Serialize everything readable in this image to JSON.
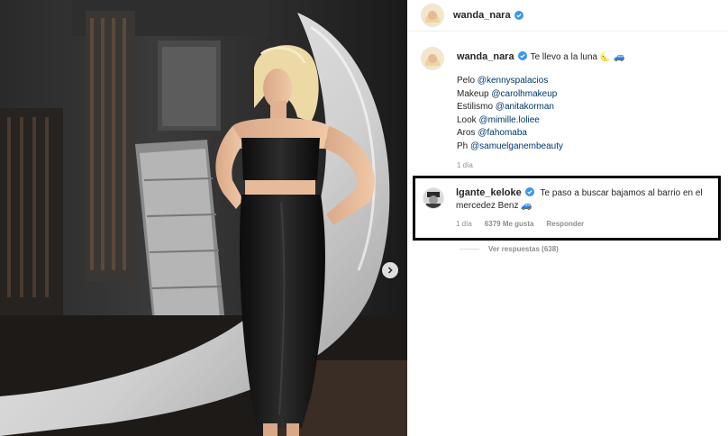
{
  "colors": {
    "accent": "#3897f0",
    "link": "#00376b",
    "muted": "#8e8e8e",
    "highlight_border": "#000000"
  },
  "post": {
    "author": "wanda_nara",
    "photo_alt": "",
    "carousel_next_icon": "chevron-right-icon"
  },
  "caption": {
    "author": "wanda_nara",
    "text": "Te llevo a la luna 🌜 🚙",
    "credits": [
      {
        "label": "Pelo ",
        "mention": "@kennyspalacios"
      },
      {
        "label": "Makeup ",
        "mention": "@carolhmakeup"
      },
      {
        "label": "Estilismo ",
        "mention": "@anitakorman"
      },
      {
        "label": "Look ",
        "mention": "@mimille.loliee"
      },
      {
        "label": "Aros ",
        "mention": "@fahomaba"
      },
      {
        "label": "Ph ",
        "mention": "@samuelganembeauty"
      }
    ],
    "time": "1 día"
  },
  "comment": {
    "author": "lgante_keloke",
    "text": "Te paso a buscar bajamos al barrio en el mercedez Benz 🚙",
    "time": "1 día",
    "likes": "6379 Me gusta",
    "reply": "Responder"
  },
  "replies": {
    "label": "Ver respuestas (638)"
  }
}
